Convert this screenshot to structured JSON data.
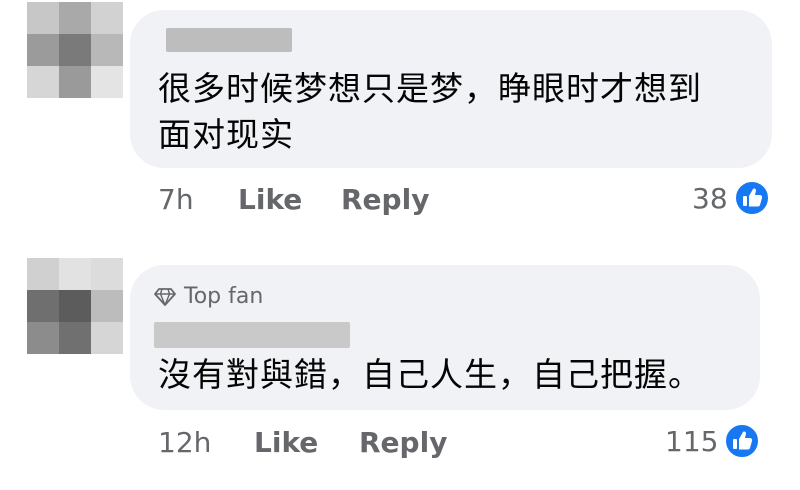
{
  "colors": {
    "bubble": "#f0f2f5",
    "text": "#050505",
    "meta": "#65676b",
    "like_blue": "#1877f2"
  },
  "comments": [
    {
      "avatar_icon": "pixelated-avatar",
      "author_redacted": true,
      "text_lines": [
        "很多时候梦想只是梦，睁眼时才想到",
        "面对现实"
      ],
      "time": "7h",
      "like_label": "Like",
      "reply_label": "Reply",
      "reaction_count": "38",
      "reaction_icon": "like-thumbs-up-icon"
    },
    {
      "avatar_icon": "pixelated-avatar",
      "badge_icon": "diamond-icon",
      "badge_label": "Top fan",
      "author_redacted": true,
      "text_lines": [
        "沒有對與錯，自己人生，自己把握。"
      ],
      "time": "12h",
      "like_label": "Like",
      "reply_label": "Reply",
      "reaction_count": "115",
      "reaction_icon": "like-thumbs-up-icon"
    }
  ]
}
